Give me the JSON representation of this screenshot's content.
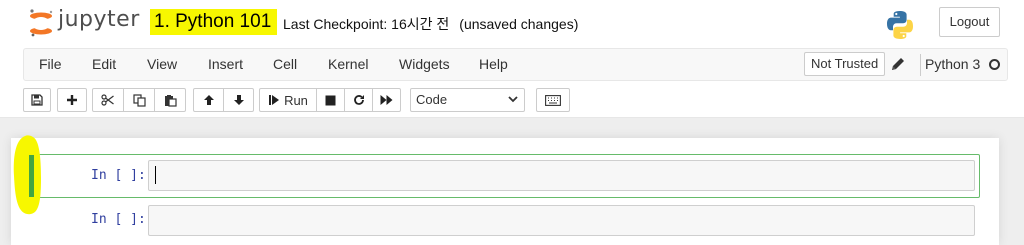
{
  "header": {
    "logo_text": "jupyter",
    "notebook_title": "1. Python 101",
    "checkpoint_label": "Last Checkpoint: 16시간 전",
    "unsaved": "(unsaved changes)",
    "logout_label": "Logout"
  },
  "menubar": {
    "items": [
      "File",
      "Edit",
      "View",
      "Insert",
      "Cell",
      "Kernel",
      "Widgets",
      "Help"
    ],
    "trust_label": "Not Trusted",
    "kernel_name": "Python 3"
  },
  "toolbar": {
    "run_label": "Run",
    "cell_type": "Code",
    "icons": [
      "save-icon",
      "plus-icon",
      "cut-icon",
      "copy-icon",
      "paste-icon",
      "arrow-up-icon",
      "arrow-down-icon",
      "step-forward-icon",
      "stop-icon",
      "restart-icon",
      "fast-forward-icon",
      "keyboard-icon"
    ]
  },
  "cells": [
    {
      "prompt": "In [ ]:",
      "content": ""
    },
    {
      "prompt": "In [ ]:",
      "content": ""
    }
  ],
  "colors": {
    "title_highlight": "#f7f700",
    "selected_cell": "#42a542",
    "prompt": "#303f9f"
  }
}
